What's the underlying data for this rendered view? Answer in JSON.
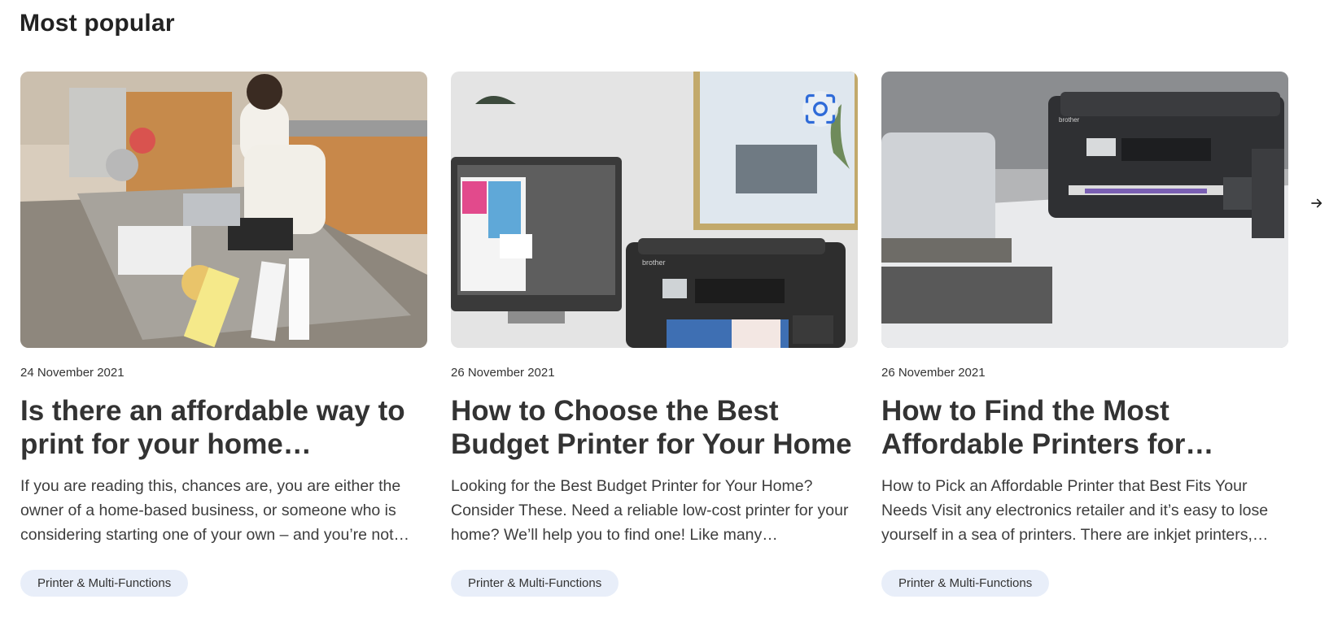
{
  "section": {
    "title": "Most popular"
  },
  "cards": [
    {
      "date": "24 November 2021",
      "title": "Is there an affordable way to print for your home…",
      "excerpt": "If you are reading this, chances are, you are either the owner of a home-based business, or someone who is considering starting one of your own – and you’re not…",
      "tag": "Printer & Multi-Functions",
      "image": "man-at-kitchen-desk-photo"
    },
    {
      "date": "26 November 2021",
      "title": "How to Choose the Best Budget Printer for Your Home",
      "excerpt": "Looking for the Best Budget Printer for Your Home? Consider These. Need a reliable low-cost printer for your home? We’ll help you to find one! Like many…",
      "tag": "Printer & Multi-Functions",
      "image": "brother-printer-and-monitor-photo",
      "overlay_icon": "visual-search-icon"
    },
    {
      "date": "26 November 2021",
      "title": "How to Find the Most Affordable Printers for…",
      "excerpt": "How to Pick an Affordable Printer that Best Fits Your Needs Visit any electronics retailer and it’s easy to lose yourself in a sea of printers. There are inkjet printers,…",
      "tag": "Printer & Multi-Functions",
      "image": "brother-printer-on-desk-photo"
    }
  ],
  "carousel": {
    "next_icon": "arrow-right-icon"
  },
  "colors": {
    "tag_bg": "#e8eef9",
    "text": "#333333"
  }
}
